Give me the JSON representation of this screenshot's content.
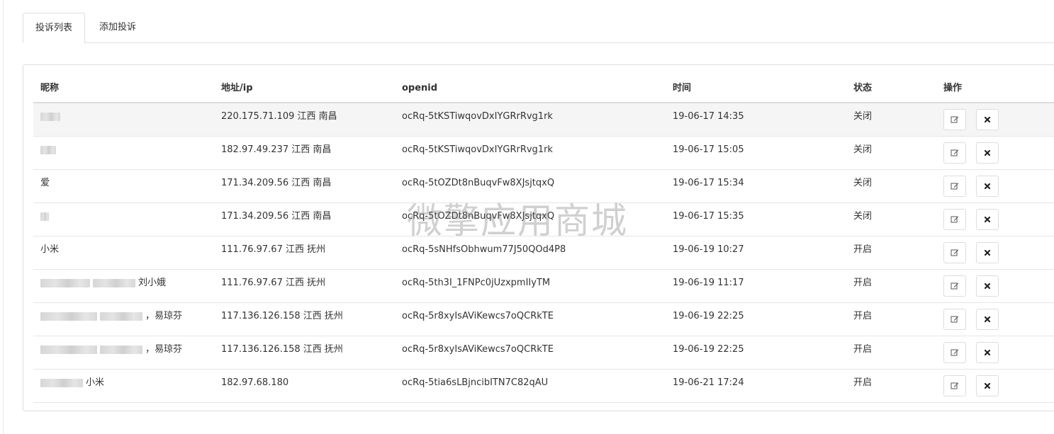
{
  "tabs": [
    {
      "label": "投诉列表",
      "active": true
    },
    {
      "label": "添加投诉",
      "active": false
    }
  ],
  "table": {
    "columns": [
      "昵称",
      "地址/ip",
      "openid",
      "时间",
      "状态",
      "操作"
    ],
    "rows": [
      {
        "nickname": "",
        "blurred": true,
        "address": "220.175.71.109 江西 南昌",
        "openid": "ocRq-5tKSTiwqovDxIYGRrRvg1rk",
        "time": "19-06-17 14:35",
        "status": "关闭"
      },
      {
        "nickname": "",
        "blurred": true,
        "address": "182.97.49.237 江西 南昌",
        "openid": "ocRq-5tKSTiwqovDxIYGRrRvg1rk",
        "time": "19-06-17 15:05",
        "status": "关闭"
      },
      {
        "nickname": "爱",
        "blurred": false,
        "address": "171.34.209.56 江西 南昌",
        "openid": "ocRq-5tOZDt8nBuqvFw8XJsjtqxQ",
        "time": "19-06-17 15:34",
        "status": "关闭"
      },
      {
        "nickname": "",
        "blurred": true,
        "address": "171.34.209.56 江西 南昌",
        "openid": "ocRq-5tOZDt8nBuqvFw8XJsjtqxQ",
        "time": "19-06-17 15:35",
        "status": "关闭"
      },
      {
        "nickname": "小米",
        "blurred": false,
        "address": "111.76.97.67 江西 抚州",
        "openid": "ocRq-5sNHfsObhwum77J50QOd4P8",
        "time": "19-06-19 10:27",
        "status": "开启"
      },
      {
        "nickname": "刘小娥",
        "blurred": true,
        "address": "111.76.97.67 江西 抚州",
        "openid": "ocRq-5th3I_1FNPc0jUzxpmIIyTM",
        "time": "19-06-19 11:17",
        "status": "开启"
      },
      {
        "nickname": "，易琼芬",
        "blurred": true,
        "address": "117.136.126.158 江西 抚州",
        "openid": "ocRq-5r8xyIsAViKewcs7oQCRkTE",
        "time": "19-06-19 22:25",
        "status": "开启"
      },
      {
        "nickname": "，易琼芬",
        "blurred": true,
        "address": "117.136.126.158 江西 抚州",
        "openid": "ocRq-5r8xyIsAViKewcs7oQCRkTE",
        "time": "19-06-19 22:25",
        "status": "开启"
      },
      {
        "nickname": "小米",
        "blurred": true,
        "address": "182.97.68.180",
        "openid": "ocRq-5tia6sLBjncibITN7C82qAU",
        "time": "19-06-21 17:24",
        "status": "开启"
      }
    ],
    "action_icons": [
      "edit-icon",
      "close-icon"
    ]
  },
  "watermark": "微擎应用商城",
  "colors": {
    "border": "#dddddd",
    "row_highlight": "#f5f5f5",
    "text": "#333333"
  }
}
